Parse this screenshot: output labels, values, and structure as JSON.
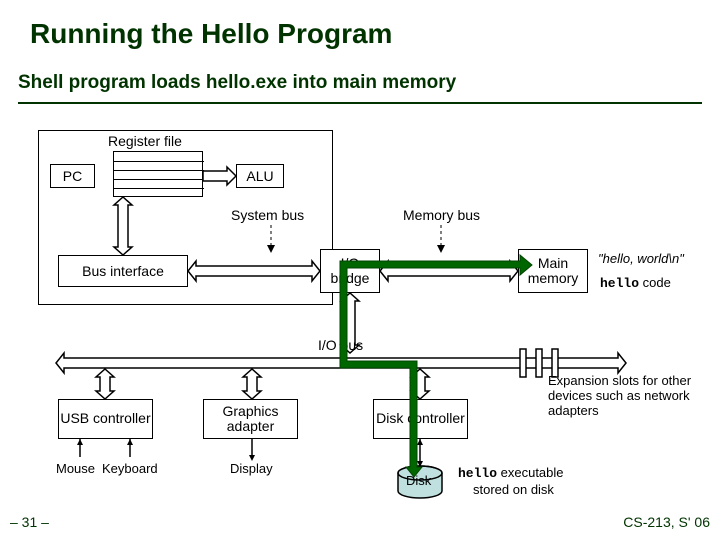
{
  "title": "Running the Hello Program",
  "subtitle": "Shell program loads hello.exe into main memory",
  "labels": {
    "register_file": "Register file",
    "pc": "PC",
    "alu": "ALU",
    "system_bus": "System bus",
    "memory_bus": "Memory bus",
    "bus_interface": "Bus interface",
    "io_bridge": "I/O bridge",
    "main_memory": "Main memory",
    "io_bus": "I/O bus",
    "usb_controller": "USB controller",
    "graphics_adapter": "Graphics adapter",
    "disk_controller": "Disk controller",
    "mouse": "Mouse",
    "keyboard": "Keyboard",
    "display": "Display",
    "disk": "Disk",
    "expansion": "Expansion slots for other devices such as network adapters",
    "hello_world": "\"hello, world\\n\"",
    "hello_code_prefix": "hello",
    "hello_code_suffix": " code",
    "hello_exec_prefix": "hello",
    "hello_exec_suffix": " executable",
    "stored_on_disk": "stored on disk"
  },
  "footer": {
    "left": "– 31 –",
    "right": "CS-213, S' 06"
  }
}
